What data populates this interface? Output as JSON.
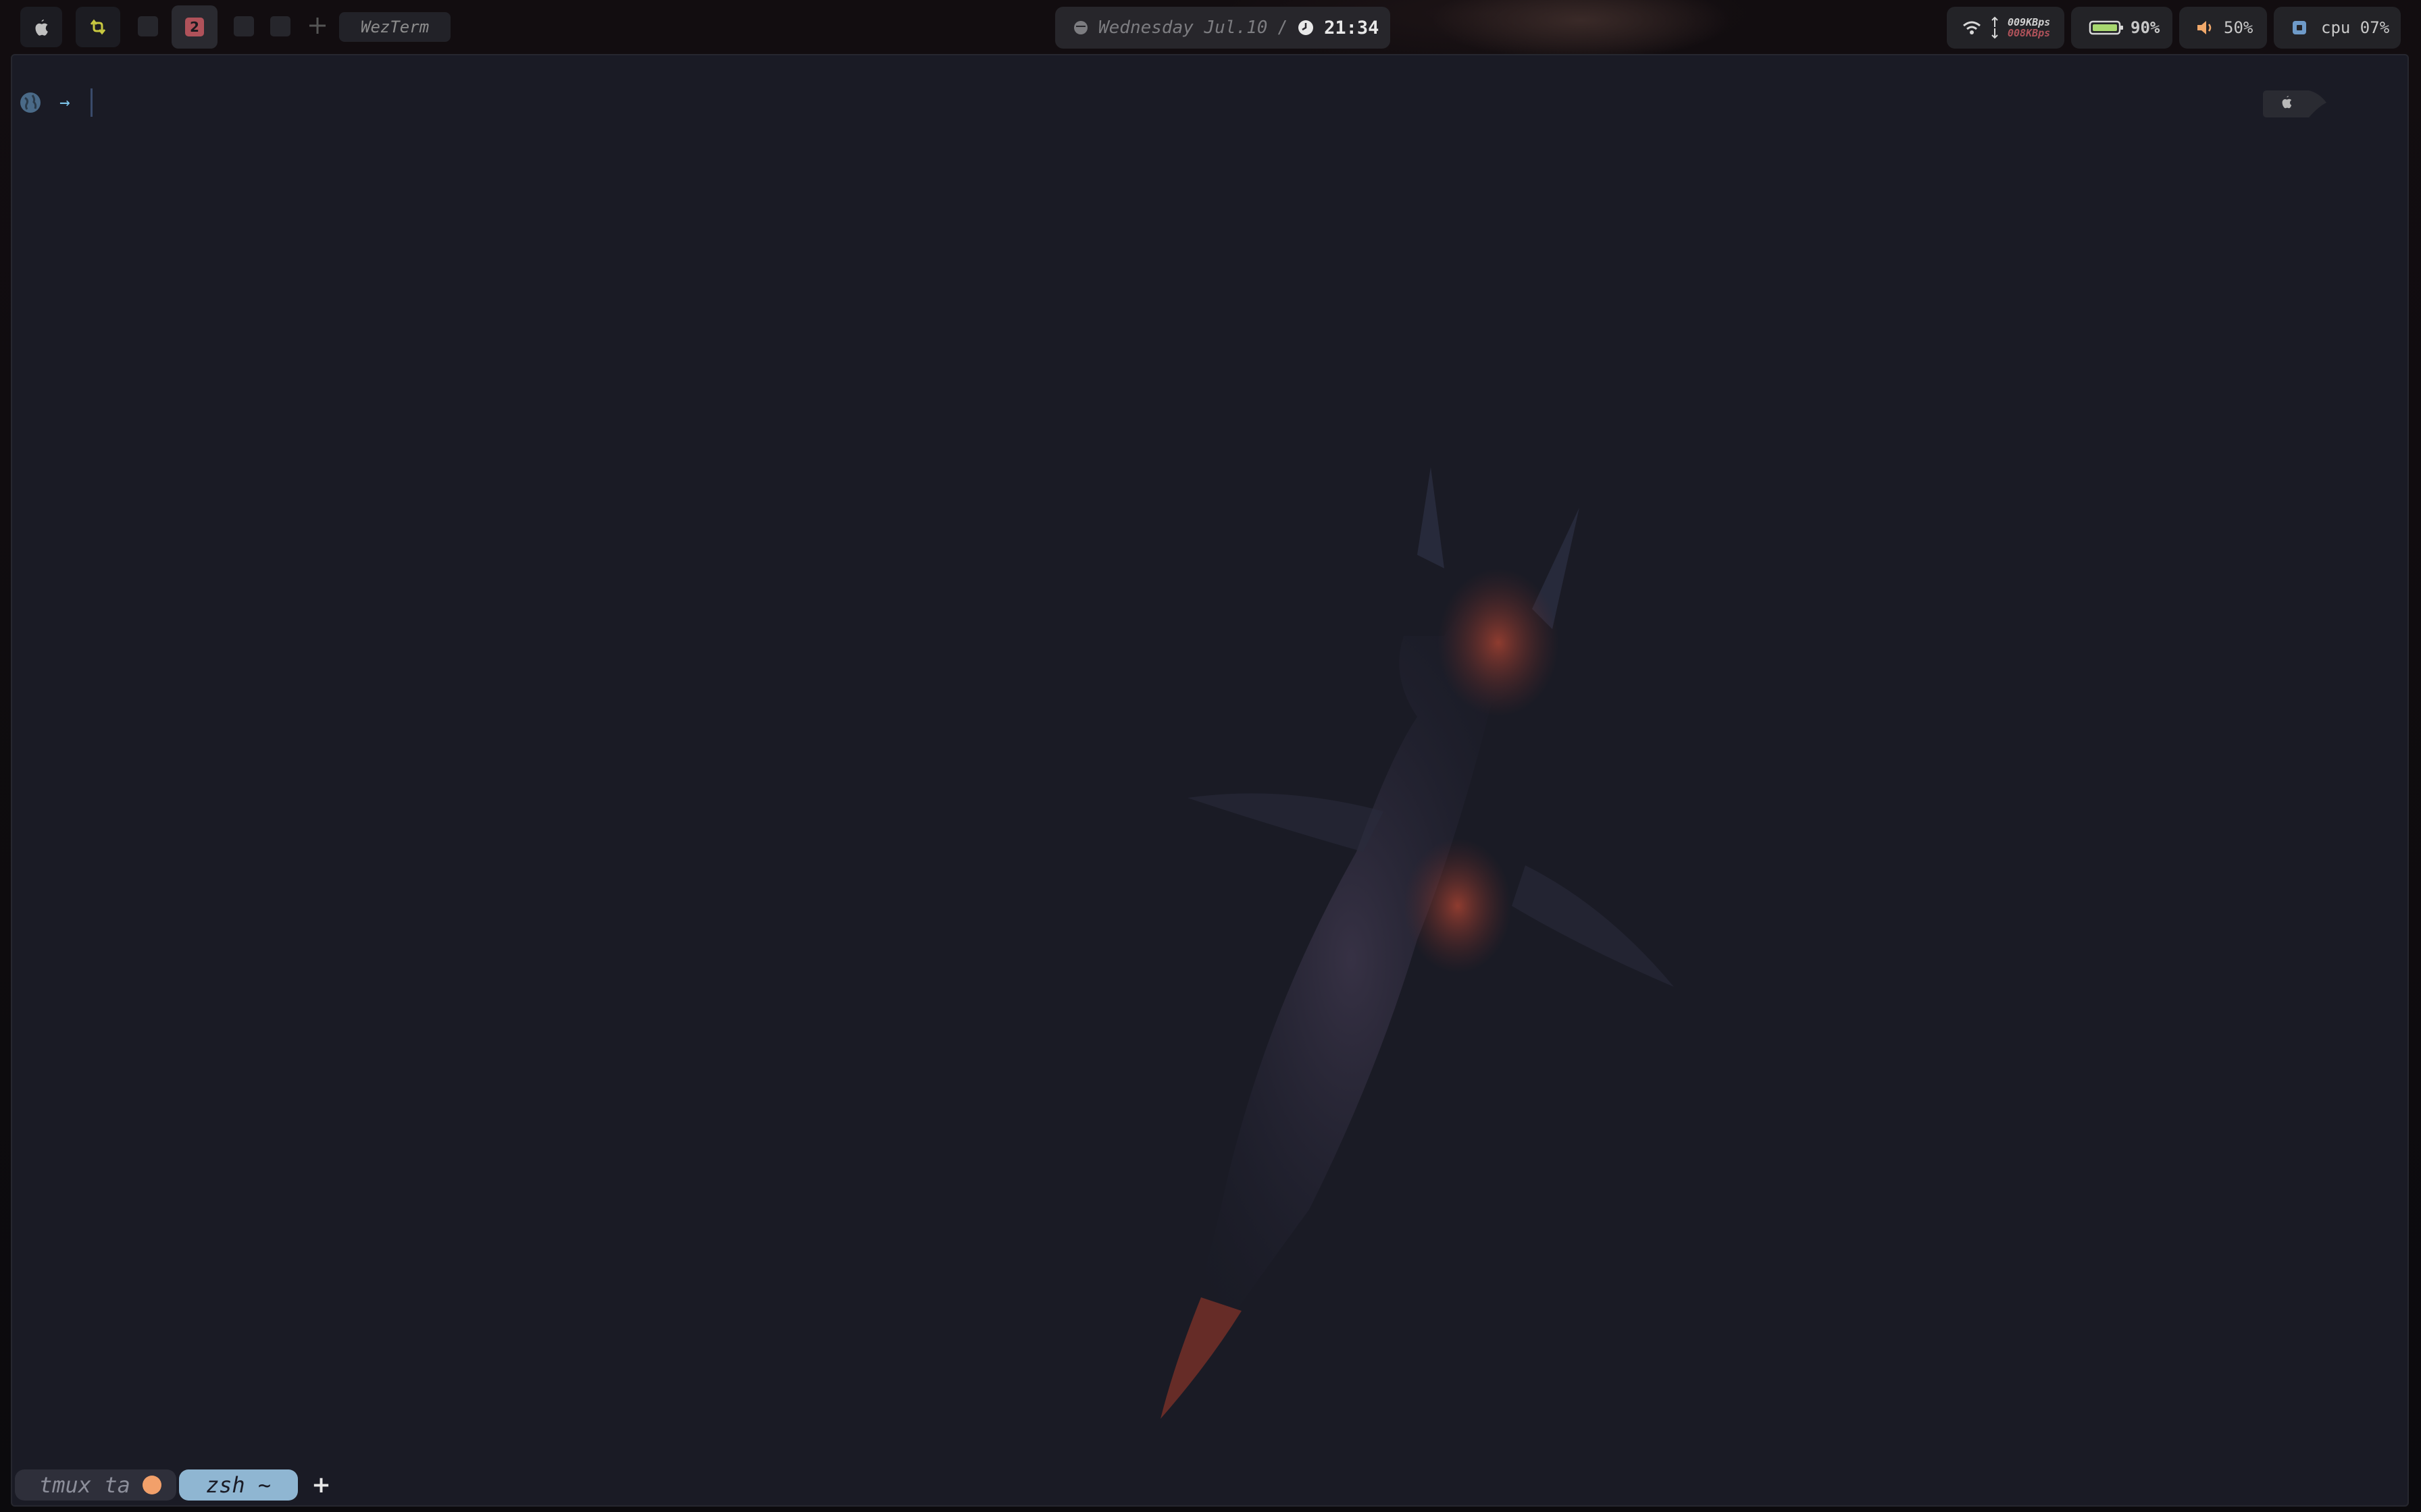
{
  "topbar": {
    "workspace_active": "2",
    "app_title": "WezTerm",
    "date": "Wednesday Jul.10",
    "separator": "/",
    "time": "21:34",
    "net_up": "009KBps",
    "net_down": "008KBps",
    "battery": "90%",
    "volume": "50%",
    "cpu": "cpu 07%"
  },
  "terminal": {
    "prompt_arrow": "→"
  },
  "tmux": {
    "session_label": "tmux ta",
    "window_label": "zsh ~",
    "add_label": "+"
  },
  "colors": {
    "terminal_bg": "#1a1b25",
    "active_tab": "#8fb6d2",
    "session_dot": "#f2a06a",
    "workspace_badge": "#b0525a",
    "prompt_arrow": "#7cc4ea"
  }
}
